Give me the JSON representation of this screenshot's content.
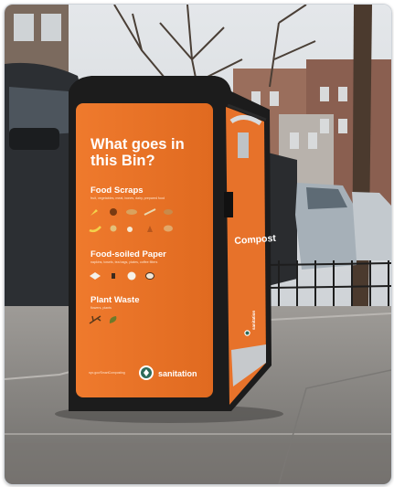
{
  "scene": "street-compost-bin",
  "bin": {
    "headline": "What goes in this Bin?",
    "sections": [
      {
        "title": "Food Scraps",
        "subtitle": "fruit, vegetables, meat, bones, dairy, prepared food"
      },
      {
        "title": "Food-soiled Paper",
        "subtitle": "napkins, towels, tea bags, plates, coffee filters"
      },
      {
        "title": "Plant Waste",
        "subtitle": "flowers, plants"
      }
    ],
    "footer_url": "nyc.gov/SmartComposting",
    "brand": "sanitation",
    "side_label": "Compost",
    "side_brand": "sanitation"
  },
  "colors": {
    "bin_orange": "#e8742a",
    "bin_black": "#1c1c1c",
    "sky": "#dfe3e6",
    "sidewalk": "#8d8b88"
  },
  "icons": {
    "food_scraps": [
      "carrot-icon",
      "tomato-icon",
      "bread-icon",
      "fish-icon",
      "egg-icon",
      "banana-icon",
      "cheese-icon",
      "bone-icon",
      "apple-icon",
      "shrimp-icon"
    ],
    "food_soiled_paper": [
      "napkin-icon",
      "teabag-icon",
      "plate-icon",
      "coffee-filter-icon"
    ],
    "plant_waste": [
      "branch-icon",
      "leaf-icon"
    ]
  }
}
